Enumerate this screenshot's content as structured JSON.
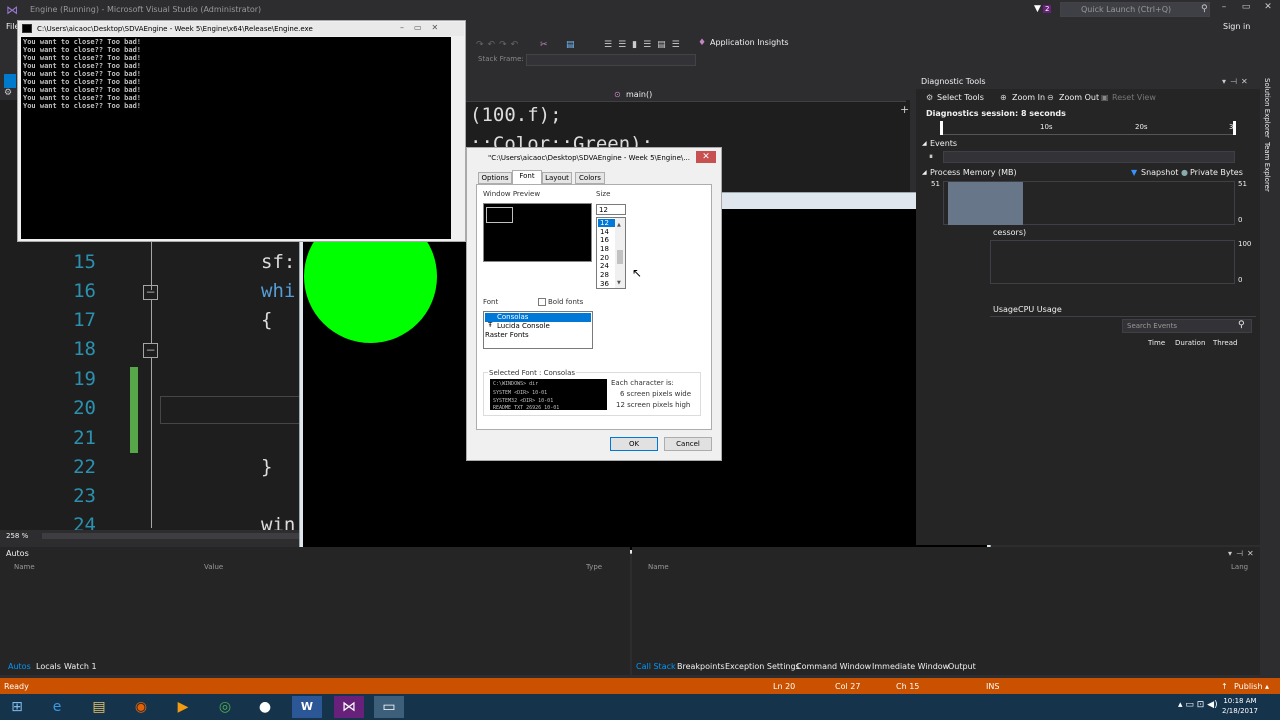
{
  "vs": {
    "title": "Engine (Running) - Microsoft Visual Studio (Administrator)",
    "quick_launch": "Quick Launch (Ctrl+Q)",
    "notif_count": "2",
    "sign_in": "Sign in",
    "file_menu": "File",
    "app_insights": "Application Insights",
    "stack_frame": "Stack Frame:",
    "nav_function": "main()",
    "zoom": "258 %"
  },
  "editor": {
    "line_numbers": [
      "15",
      "16",
      "17",
      "18",
      "19",
      "20",
      "21",
      "22",
      "23",
      "24"
    ],
    "frag_top_1": "(100.f);",
    "frag_top_2": "::Color::Green);",
    "line15": "sf:",
    "line16": "whi",
    "line17": "{",
    "line22": "}",
    "line24": "win"
  },
  "console": {
    "title": "C:\\Users\\aicaoc\\Desktop\\SDVAEngine - Week 5\\Engine\\x64\\Release\\Engine.exe",
    "lines": [
      "You want to close?? Too bad!",
      "You want to close?? Too bad!",
      "You want to close?? Too bad!",
      "You want to close?? Too bad!",
      "You want to close?? Too bad!",
      "You want to close?? Too bad!",
      "You want to close?? Too bad!",
      "You want to close?? Too bad!",
      "You want to close?? Too bad!"
    ]
  },
  "dialog": {
    "title": "\"C:\\Users\\aicaoc\\Desktop\\SDVAEngine - Week 5\\Engine\\...",
    "close": "✕",
    "tabs": [
      "Options",
      "Font",
      "Layout",
      "Colors"
    ],
    "window_preview": "Window Preview",
    "size_label": "Size",
    "size_value": "12",
    "sizes": [
      "12",
      "14",
      "16",
      "18",
      "20",
      "24",
      "28",
      "36"
    ],
    "font_label": "Font",
    "bold_fonts": "Bold fonts",
    "fonts": [
      "Consolas",
      "Lucida Console",
      "Raster Fonts"
    ],
    "selected_font": "Selected Font : Consolas",
    "sample_lines": [
      "C:\\WINDOWS> dir",
      "SYSTEM        <DIR>     10-01",
      "SYSTEM32      <DIR>     10-01",
      "README   TXT      26926 10-01"
    ],
    "char_is": "Each character is:",
    "char_wide": "6 screen pixels wide",
    "char_high": "12 screen pixels high",
    "ok": "OK",
    "cancel": "Cancel"
  },
  "diagnostics": {
    "title": "Diagnostic Tools",
    "select_tools": "Select Tools",
    "zoom_in": "Zoom In",
    "zoom_out": "Zoom Out",
    "reset_view": "Reset View",
    "session": "Diagnostics session: 8 seconds",
    "ticks": [
      "10s",
      "20s",
      "3"
    ],
    "events": "Events",
    "process_memory": "Process Memory (MB)",
    "snapshot": "Snapshot",
    "private_bytes": "Private Bytes",
    "mem_max": "51",
    "mem_min": "0",
    "cpu_label": "cessors)",
    "cpu_max": "100",
    "cpu_min": "0",
    "usage_tab": "Usage",
    "cpu_usage_tab": "CPU Usage",
    "search_events": "Search Events",
    "cols": [
      "Time",
      "Duration",
      "Thread"
    ]
  },
  "right_tabs": [
    "Solution Explorer",
    "Team Explorer"
  ],
  "autos": {
    "title": "Autos",
    "cols": [
      "Name",
      "Value",
      "Type"
    ],
    "tabs": [
      "Autos",
      "Locals",
      "Watch 1"
    ]
  },
  "callstack": {
    "cols": [
      "Name",
      "Lang"
    ],
    "tabs": [
      "Call Stack",
      "Breakpoints",
      "Exception Settings",
      "Command Window",
      "Immediate Window",
      "Output"
    ]
  },
  "status": {
    "ready": "Ready",
    "ln": "Ln 20",
    "col": "Col 27",
    "ch": "Ch 15",
    "ins": "INS",
    "publish": "Publish"
  },
  "taskbar": {
    "time": "10:18 AM",
    "date": "2/18/2017"
  },
  "colors": {
    "status_bar": "#ca5100",
    "sfml_circle": "#00ff00",
    "taskbar": "#16334c"
  }
}
